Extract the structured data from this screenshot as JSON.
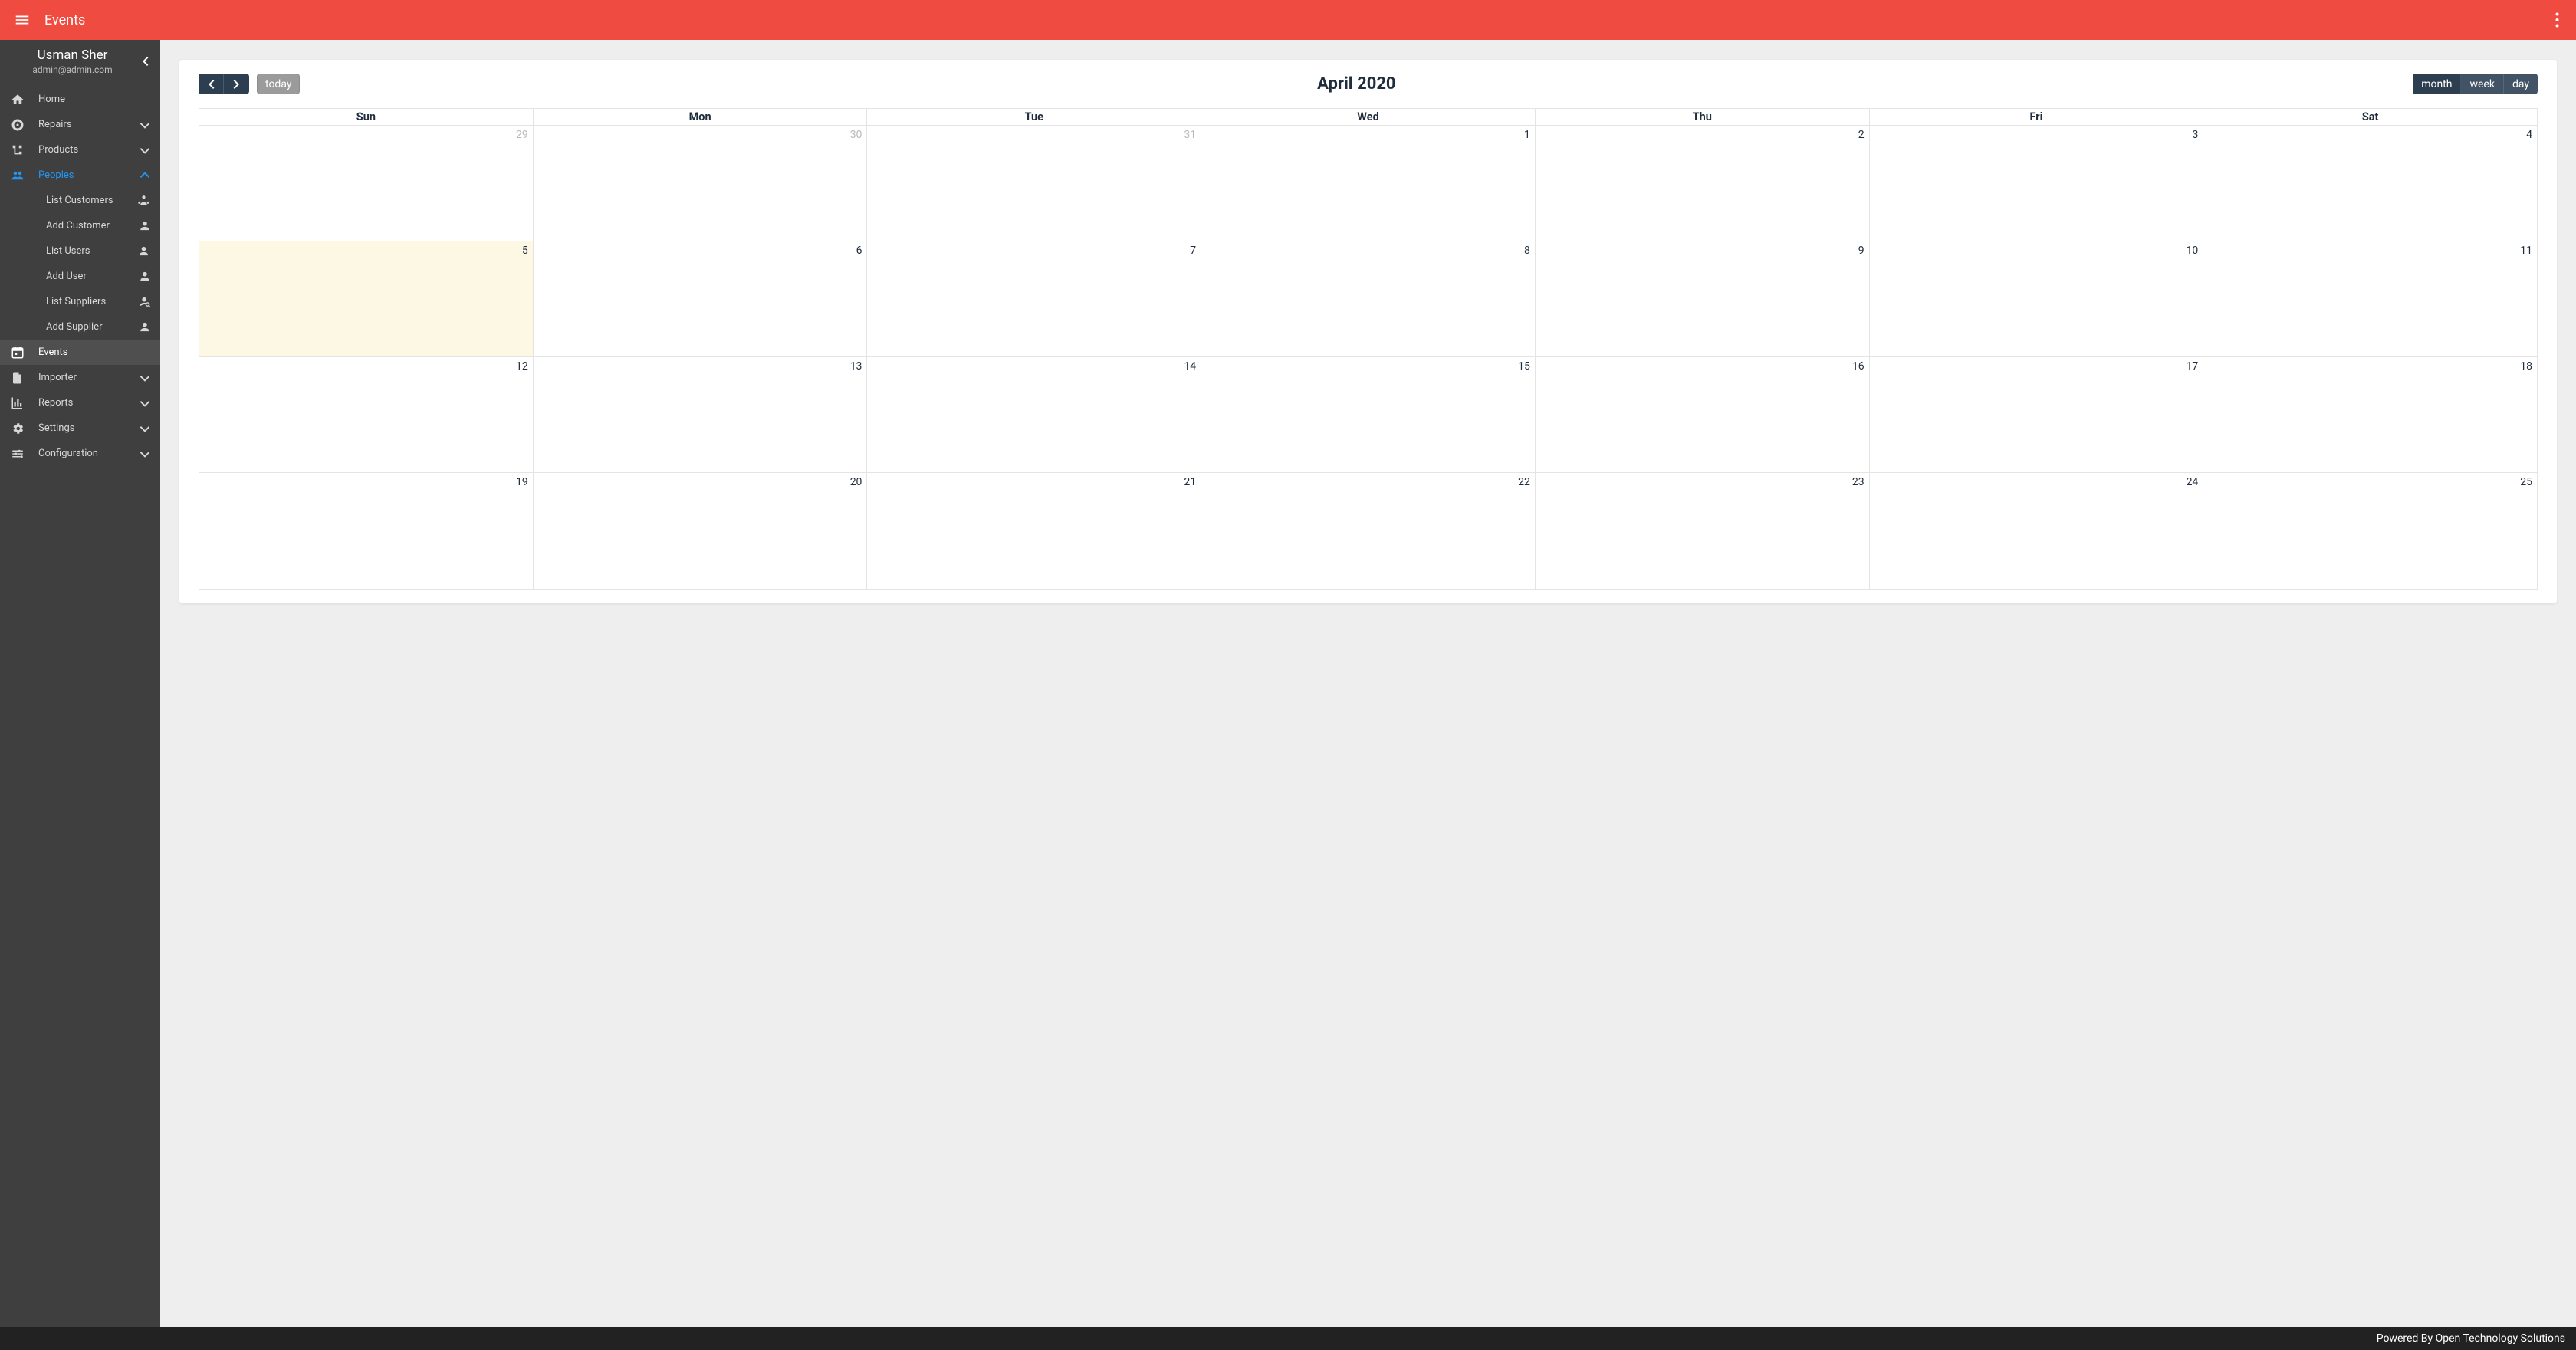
{
  "topbar": {
    "title": "Events"
  },
  "user": {
    "name": "Usman Sher",
    "email": "admin@admin.com"
  },
  "nav": {
    "home": "Home",
    "repairs": "Repairs",
    "products": "Products",
    "peoples": "Peoples",
    "peoples_children": {
      "list_customers": "List Customers",
      "add_customer": "Add Customer",
      "list_users": "List Users",
      "add_user": "Add User",
      "list_suppliers": "List Suppliers",
      "add_supplier": "Add Supplier"
    },
    "events": "Events",
    "importer": "Importer",
    "reports": "Reports",
    "settings": "Settings",
    "configuration": "Configuration"
  },
  "calendar": {
    "title": "April 2020",
    "today_label": "today",
    "views": {
      "month": "month",
      "week": "week",
      "day": "day"
    },
    "dow": [
      "Sun",
      "Mon",
      "Tue",
      "Wed",
      "Thu",
      "Fri",
      "Sat"
    ],
    "weeks": [
      [
        {
          "n": "29",
          "other": true
        },
        {
          "n": "30",
          "other": true
        },
        {
          "n": "31",
          "other": true
        },
        {
          "n": "1"
        },
        {
          "n": "2"
        },
        {
          "n": "3"
        },
        {
          "n": "4"
        }
      ],
      [
        {
          "n": "5",
          "today": true
        },
        {
          "n": "6"
        },
        {
          "n": "7"
        },
        {
          "n": "8"
        },
        {
          "n": "9"
        },
        {
          "n": "10"
        },
        {
          "n": "11"
        }
      ],
      [
        {
          "n": "12"
        },
        {
          "n": "13"
        },
        {
          "n": "14"
        },
        {
          "n": "15"
        },
        {
          "n": "16"
        },
        {
          "n": "17"
        },
        {
          "n": "18"
        }
      ],
      [
        {
          "n": "19"
        },
        {
          "n": "20"
        },
        {
          "n": "21"
        },
        {
          "n": "22"
        },
        {
          "n": "23"
        },
        {
          "n": "24"
        },
        {
          "n": "25"
        }
      ]
    ]
  },
  "footer": {
    "text": "Powered By Open Technology Solutions"
  }
}
